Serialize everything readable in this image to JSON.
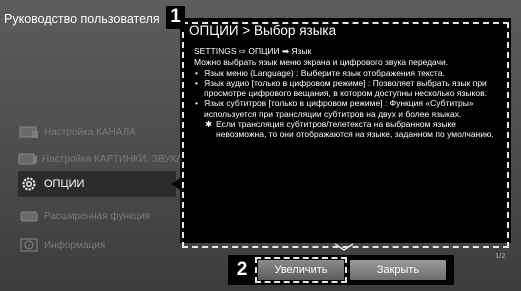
{
  "manual_title": "Руководство пользователя",
  "markers": {
    "one": "1",
    "two": "2"
  },
  "menu": {
    "items": [
      {
        "label": "Настройка КАНАЛА",
        "icon": "channel-settings-icon"
      },
      {
        "label": "Настройка КАРТИНКИ, ЗВУКА",
        "icon": "picture-sound-icon"
      },
      {
        "label": "ОПЦИИ",
        "icon": "gear-icon"
      },
      {
        "label": "Расширенная функция",
        "icon": "advanced-function-icon"
      },
      {
        "label": "Информация",
        "icon": "info-icon"
      }
    ],
    "active_index": 2
  },
  "help": {
    "title": "ОПЦИИ > Выбор языка",
    "path": "SETTINGS ⇨ ОПЦИИ ➡ Язык",
    "intro": "Можно выбрать язык меню экрана и цифрового звука передачи.",
    "bullets": [
      "Язык меню (Language) : Выберите язык отображения текста.",
      "Язык аудио [только в цифровом режиме] : Позволяет выбрать язык при просмотре цифрового вещания, в котором доступны несколько языков.",
      "Язык субтитров [только в цифровом режиме] : Функция «Субтитры» используется при трансляции субтитров на двух и более языках."
    ],
    "note_mark": "✱",
    "note": "Если трансляция субтитров/телетекста на выбранном языке невозможна, то они отображаются на языке, заданном по умолчанию."
  },
  "page_counter": "1/2",
  "buttons": {
    "enlarge": "Увеличить",
    "close": "Закрыть"
  }
}
